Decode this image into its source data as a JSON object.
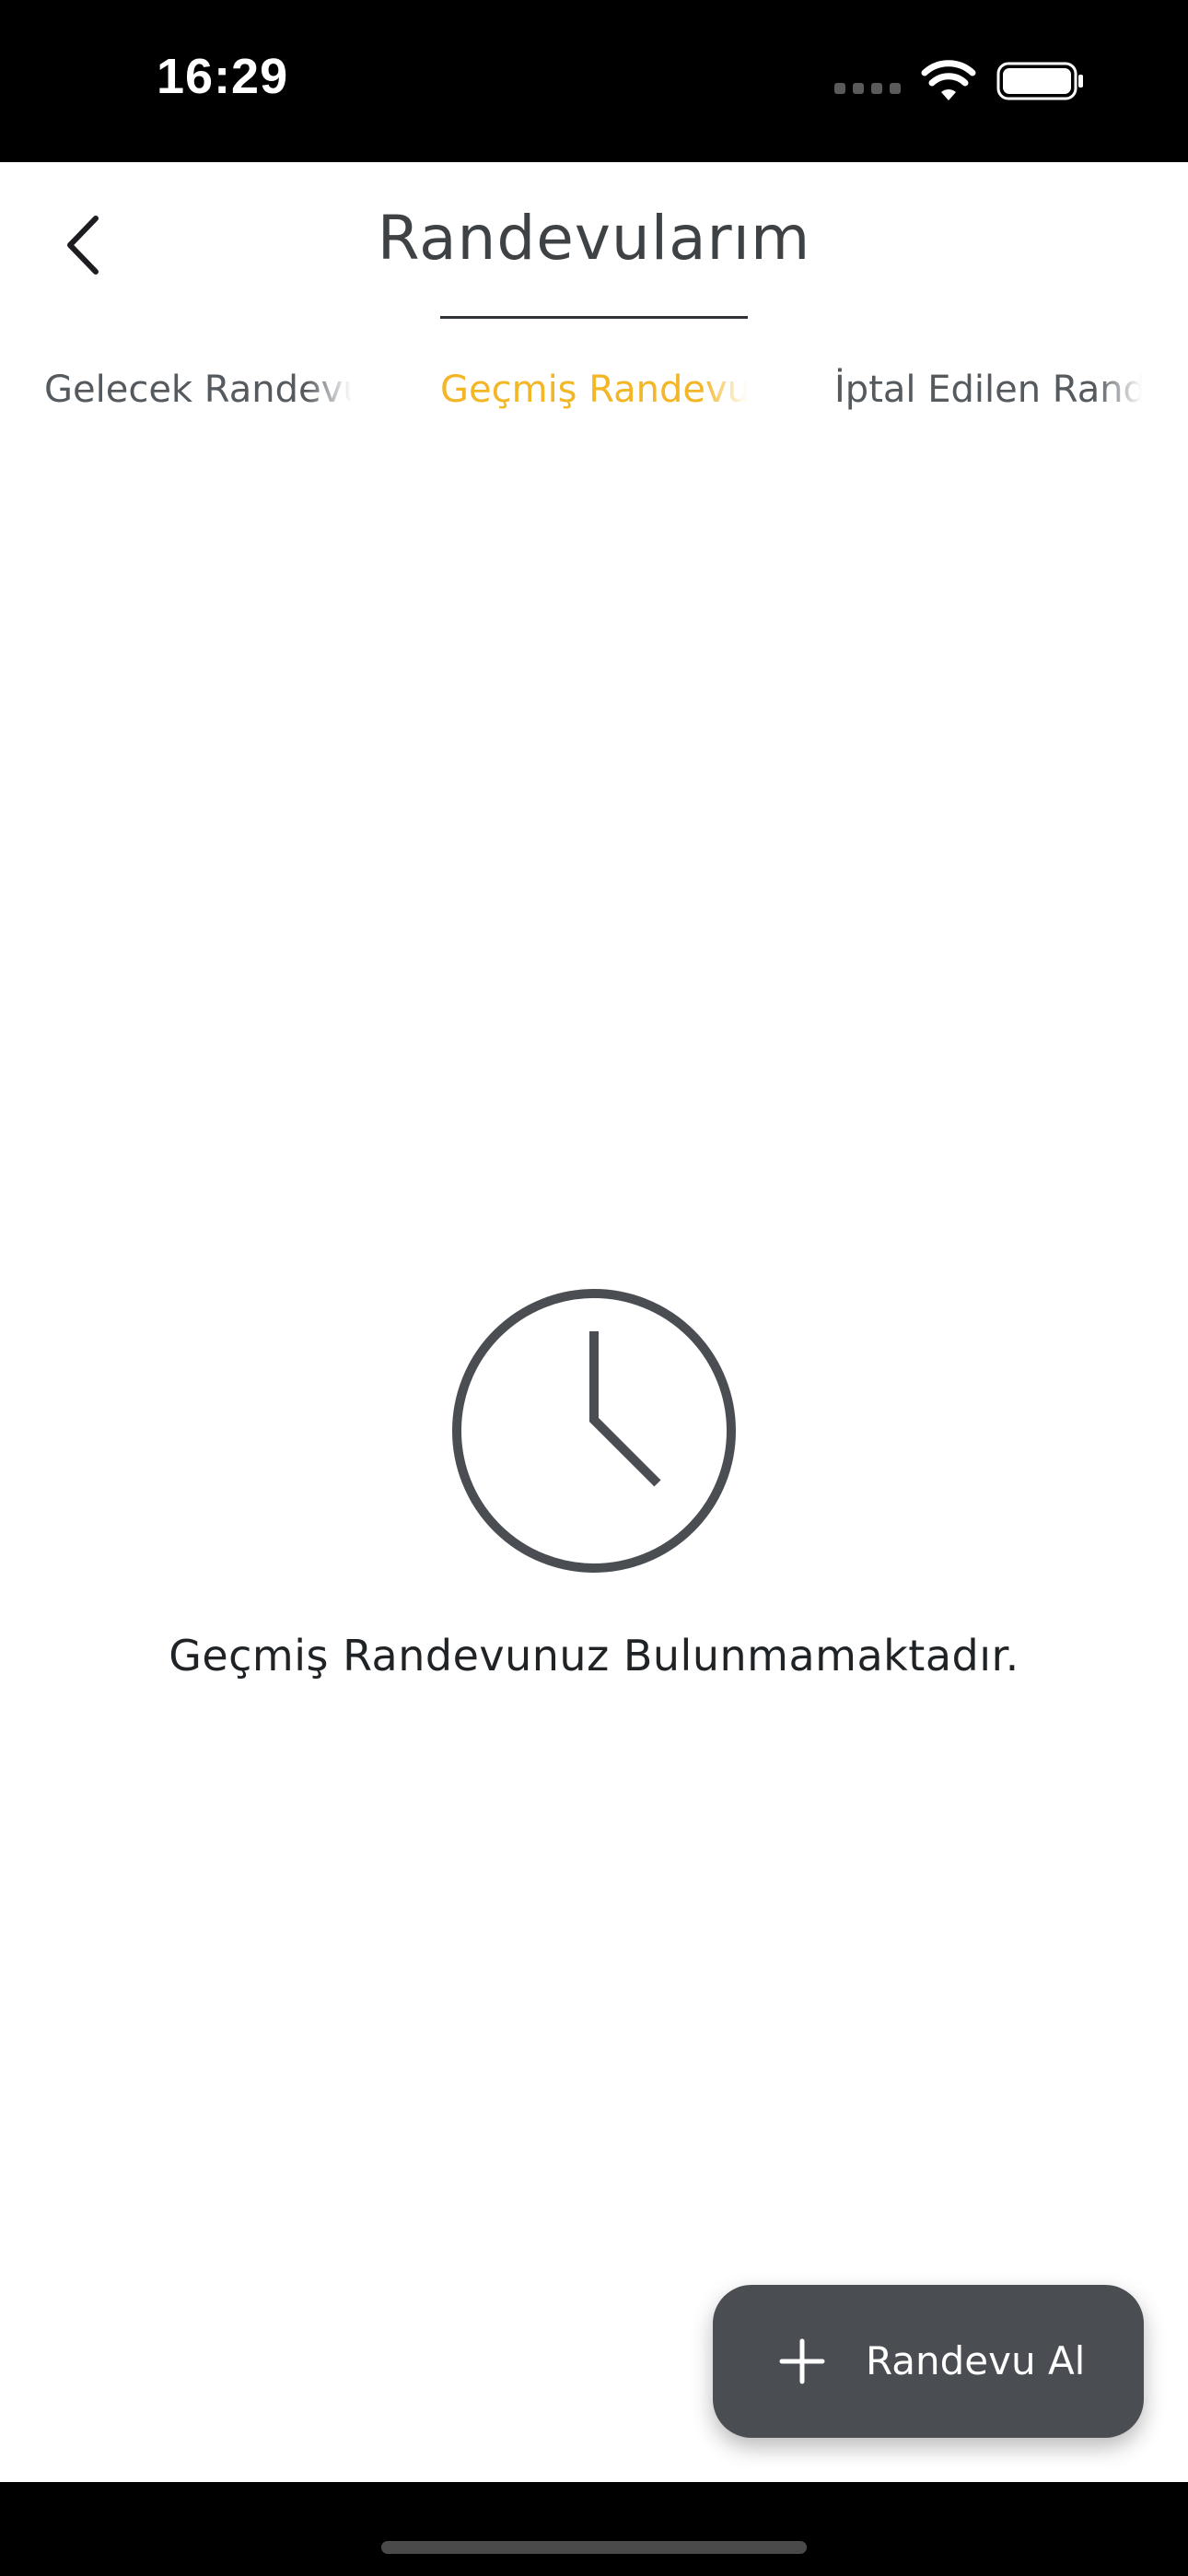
{
  "status_bar": {
    "time": "16:29"
  },
  "header": {
    "title": "Randevularım",
    "back_icon": "chevron-left-icon"
  },
  "tabs": [
    {
      "label": "Gelecek Randevular",
      "active": false
    },
    {
      "label": "Geçmiş Randevular",
      "active": true
    },
    {
      "label": "İptal Edilen Randevular",
      "active": false
    }
  ],
  "empty_state": {
    "icon": "clock-icon",
    "message": "Geçmiş Randevunuz Bulunmamaktadır."
  },
  "fab": {
    "icon": "plus-icon",
    "label": "Randevu Al"
  },
  "colors": {
    "accent": "#f2b626",
    "fab_background": "#4a4e53",
    "text_dark": "#202326",
    "icon_gray": "#4a4e53"
  }
}
